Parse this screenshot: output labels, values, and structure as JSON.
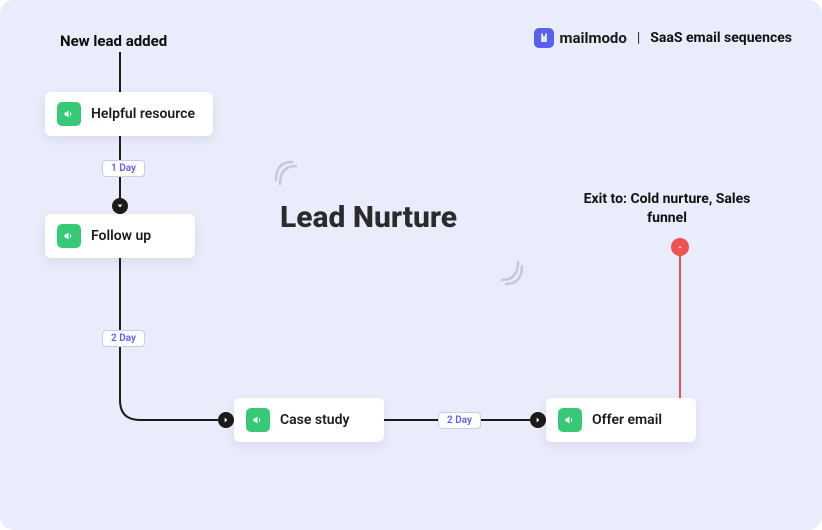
{
  "brand": {
    "name": "mailmodo",
    "subtitle": "SaaS email sequences",
    "separator": "|"
  },
  "diagram": {
    "title": "Lead Nurture",
    "start_label": "New lead added",
    "nodes": {
      "n1": "Helpful resource",
      "n2": "Follow up",
      "n3": "Case study",
      "n4": "Offer email"
    },
    "delays": {
      "d1": "1 Day",
      "d2": "2 Day",
      "d3": "2 Day"
    },
    "exit_label": "Exit to: Cold nurture, Sales funnel"
  }
}
